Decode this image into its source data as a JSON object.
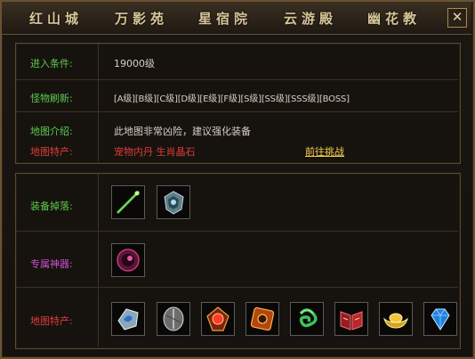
{
  "tabs": [
    {
      "label": "红山城"
    },
    {
      "label": "万影苑"
    },
    {
      "label": "星宿院"
    },
    {
      "label": "云游殿"
    },
    {
      "label": "幽花教"
    }
  ],
  "close_label": "✕",
  "info": {
    "entry_label": "进入条件:",
    "entry_value": "19000级",
    "refresh_label": "怪物刷新:",
    "refresh_value": "[A级][B级][C级][D级][E级][F级][S级][SS级][SSS级][BOSS]",
    "intro_label": "地图介绍:",
    "intro_value": "此地图非常凶险，建议强化装备",
    "produce_label": "地图特产:",
    "produce_value": "宠物内丹 生肖晶石",
    "challenge_link": "前往挑战"
  },
  "drops": {
    "equip_label": "装备掉落:",
    "equip_items": [
      "green-staff-icon",
      "armor-gauntlet-icon"
    ],
    "exclusive_label": "专属神器:",
    "exclusive_items": [
      "dark-orb-icon"
    ],
    "produce_label": "地图特产:",
    "produce_items": [
      "blue-rune-stone-icon",
      "silver-shield-stone-icon",
      "red-gem-medal-icon",
      "orange-rune-tile-icon",
      "green-jade-knot-icon",
      "red-scroll-book-icon",
      "gold-ingot-icon",
      "blue-diamond-icon"
    ]
  }
}
